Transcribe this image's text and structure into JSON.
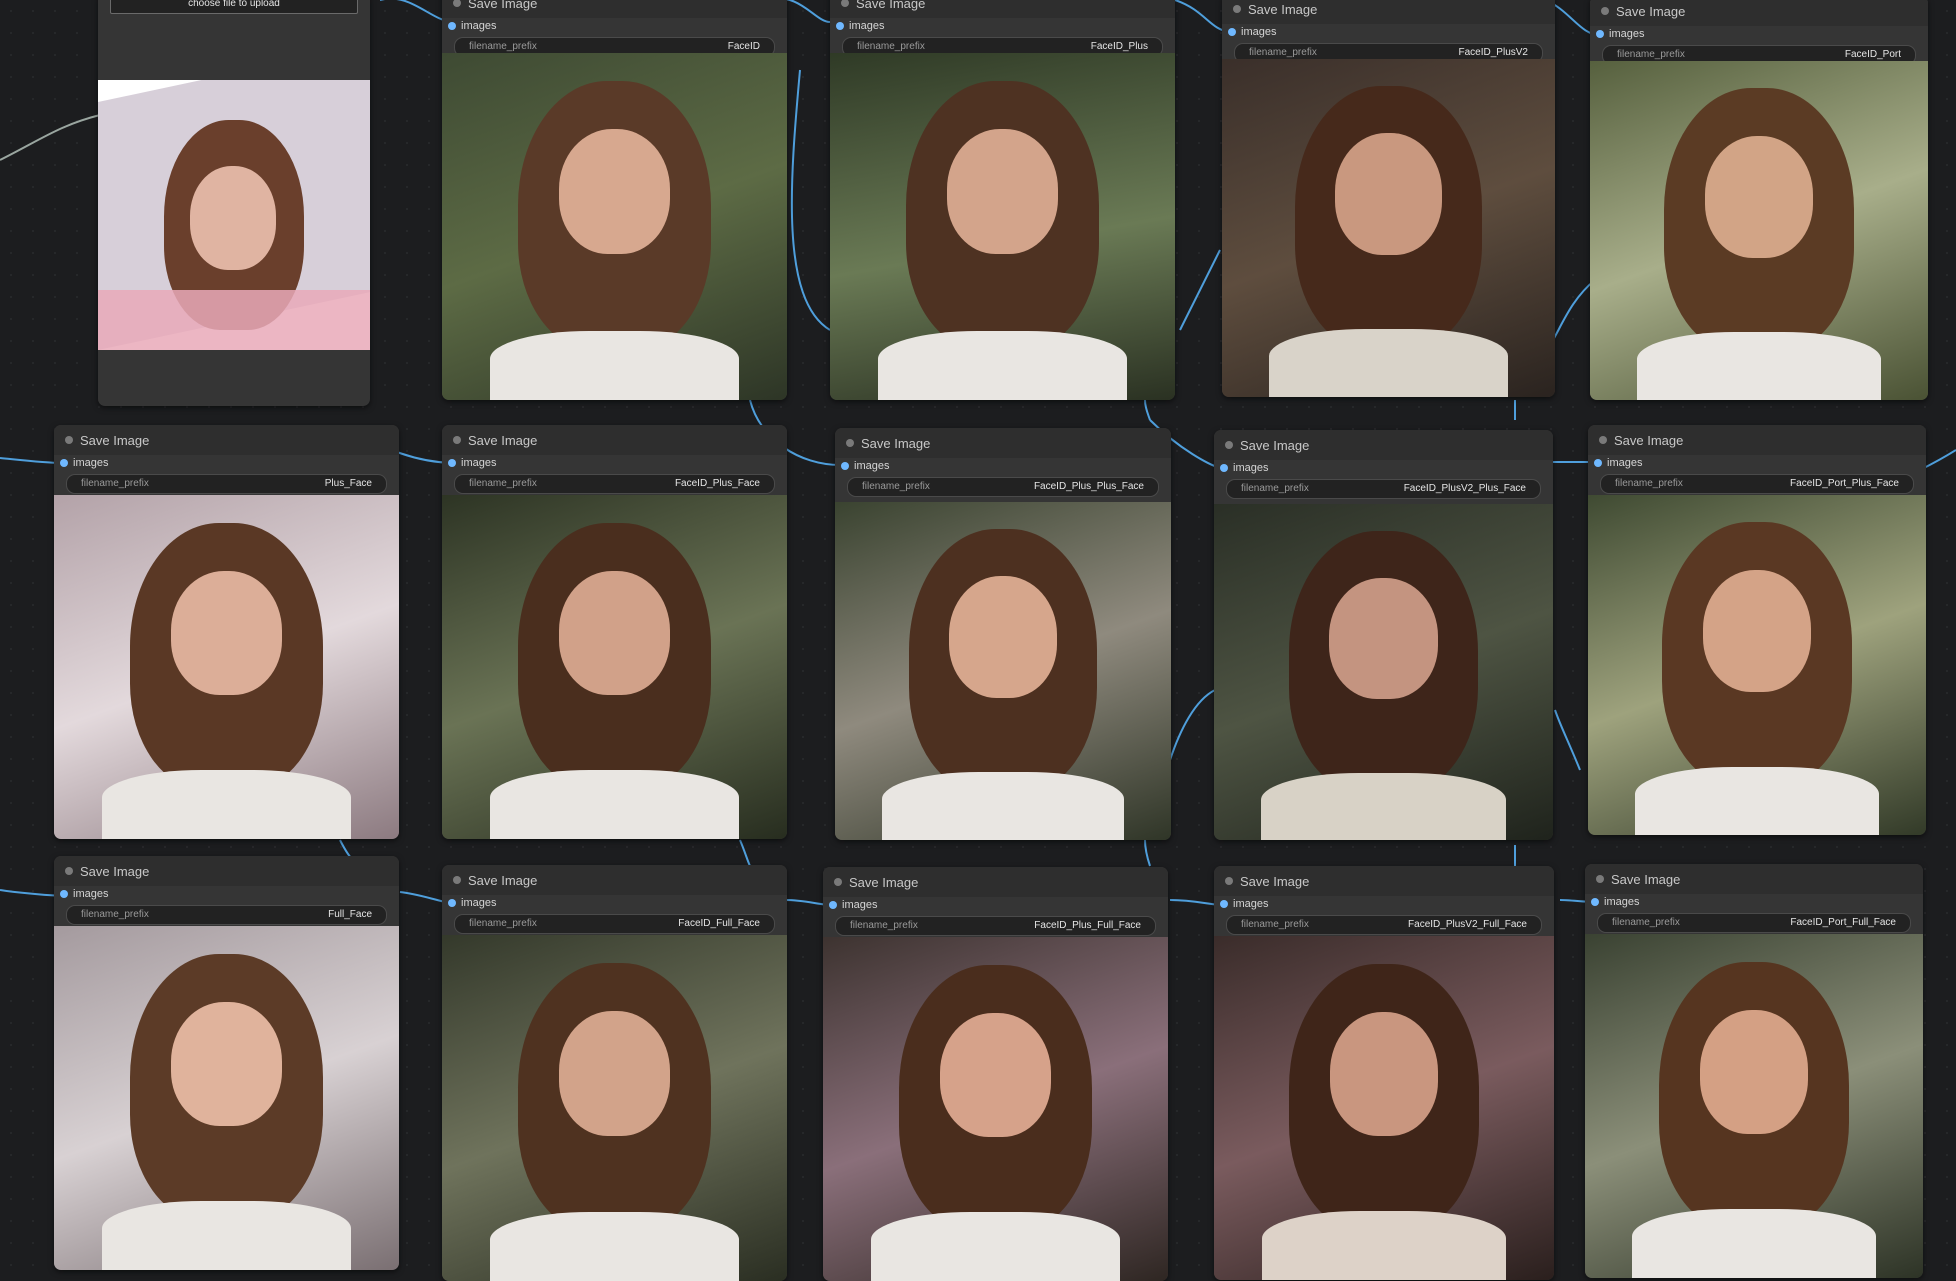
{
  "load_node": {
    "upload_button": "choose file to upload"
  },
  "nodes": [
    {
      "title": "Save Image",
      "input": "images",
      "widget_label": "filename_prefix",
      "widget_value": "FaceID"
    },
    {
      "title": "Save Image",
      "input": "images",
      "widget_label": "filename_prefix",
      "widget_value": "FaceID_Plus"
    },
    {
      "title": "Save Image",
      "input": "images",
      "widget_label": "filename_prefix",
      "widget_value": "FaceID_PlusV2"
    },
    {
      "title": "Save Image",
      "input": "images",
      "widget_label": "filename_prefix",
      "widget_value": "FaceID_Port"
    },
    {
      "title": "Save Image",
      "input": "images",
      "widget_label": "filename_prefix",
      "widget_value": "Plus_Face"
    },
    {
      "title": "Save Image",
      "input": "images",
      "widget_label": "filename_prefix",
      "widget_value": "FaceID_Plus_Face"
    },
    {
      "title": "Save Image",
      "input": "images",
      "widget_label": "filename_prefix",
      "widget_value": "FaceID_Plus_Plus_Face"
    },
    {
      "title": "Save Image",
      "input": "images",
      "widget_label": "filename_prefix",
      "widget_value": "FaceID_PlusV2_Plus_Face"
    },
    {
      "title": "Save Image",
      "input": "images",
      "widget_label": "filename_prefix",
      "widget_value": "FaceID_Port_Plus_Face"
    },
    {
      "title": "Save Image",
      "input": "images",
      "widget_label": "filename_prefix",
      "widget_value": "Full_Face"
    },
    {
      "title": "Save Image",
      "input": "images",
      "widget_label": "filename_prefix",
      "widget_value": "FaceID_Full_Face"
    },
    {
      "title": "Save Image",
      "input": "images",
      "widget_label": "filename_prefix",
      "widget_value": "FaceID_Plus_Full_Face"
    },
    {
      "title": "Save Image",
      "input": "images",
      "widget_label": "filename_prefix",
      "widget_value": "FaceID_PlusV2_Full_Face"
    },
    {
      "title": "Save Image",
      "input": "images",
      "widget_label": "filename_prefix",
      "widget_value": "FaceID_Port_Full_Face"
    }
  ],
  "colors": {
    "canvas": "#1c1d1f",
    "node_body": "#353535",
    "wire": "#5aa9e6",
    "input_slot": "#6fb8ff"
  }
}
